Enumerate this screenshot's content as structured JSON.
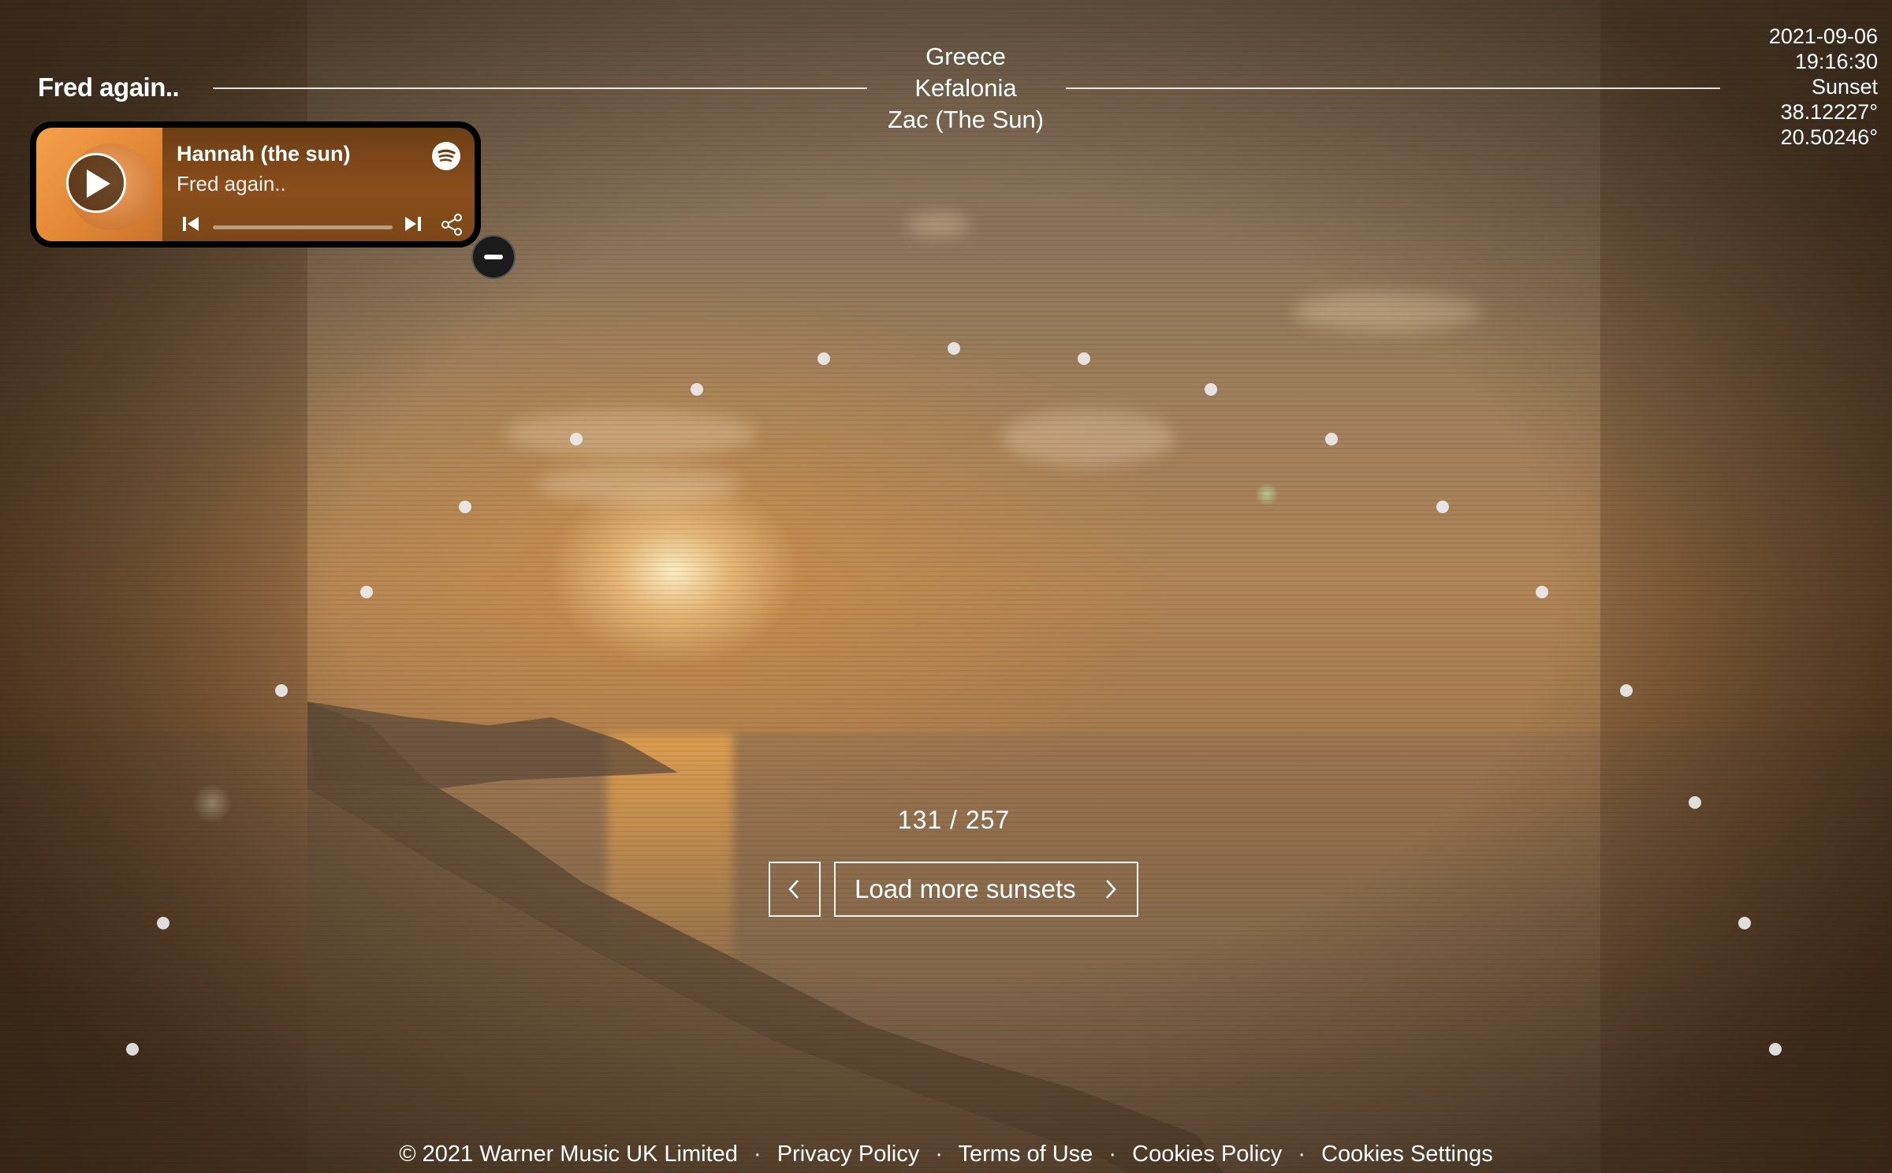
{
  "header": {
    "brand": "Fred again..",
    "location": {
      "country": "Greece",
      "place": "Kefalonia",
      "contributor": "Zac (The Sun)"
    },
    "meta": {
      "date": "2021-09-06",
      "time": "19:16:30",
      "event": "Sunset",
      "latitude": "38.12227°",
      "longitude": "20.50246°"
    }
  },
  "player": {
    "track_title": "Hannah (the sun)",
    "artist": "Fred again..",
    "progress": 0,
    "icons": [
      "play-icon",
      "spotify-icon",
      "skip-back-icon",
      "skip-forward-icon",
      "share-icon",
      "minus-icon"
    ]
  },
  "navigation": {
    "counter": "131 / 257",
    "load_more_label": "Load more sunsets",
    "prev_icon": "chevron-left-icon",
    "next_icon": "chevron-right-icon"
  },
  "footer": {
    "copyright": "© 2021 Warner Music UK Limited",
    "links": [
      "Privacy Policy",
      "Terms of Use",
      "Cookies Policy",
      "Cookies Settings"
    ],
    "separator": "·"
  },
  "colors": {
    "text": "#ffffff",
    "player_bg": "#000000",
    "accent_orange": "#e58a36"
  }
}
